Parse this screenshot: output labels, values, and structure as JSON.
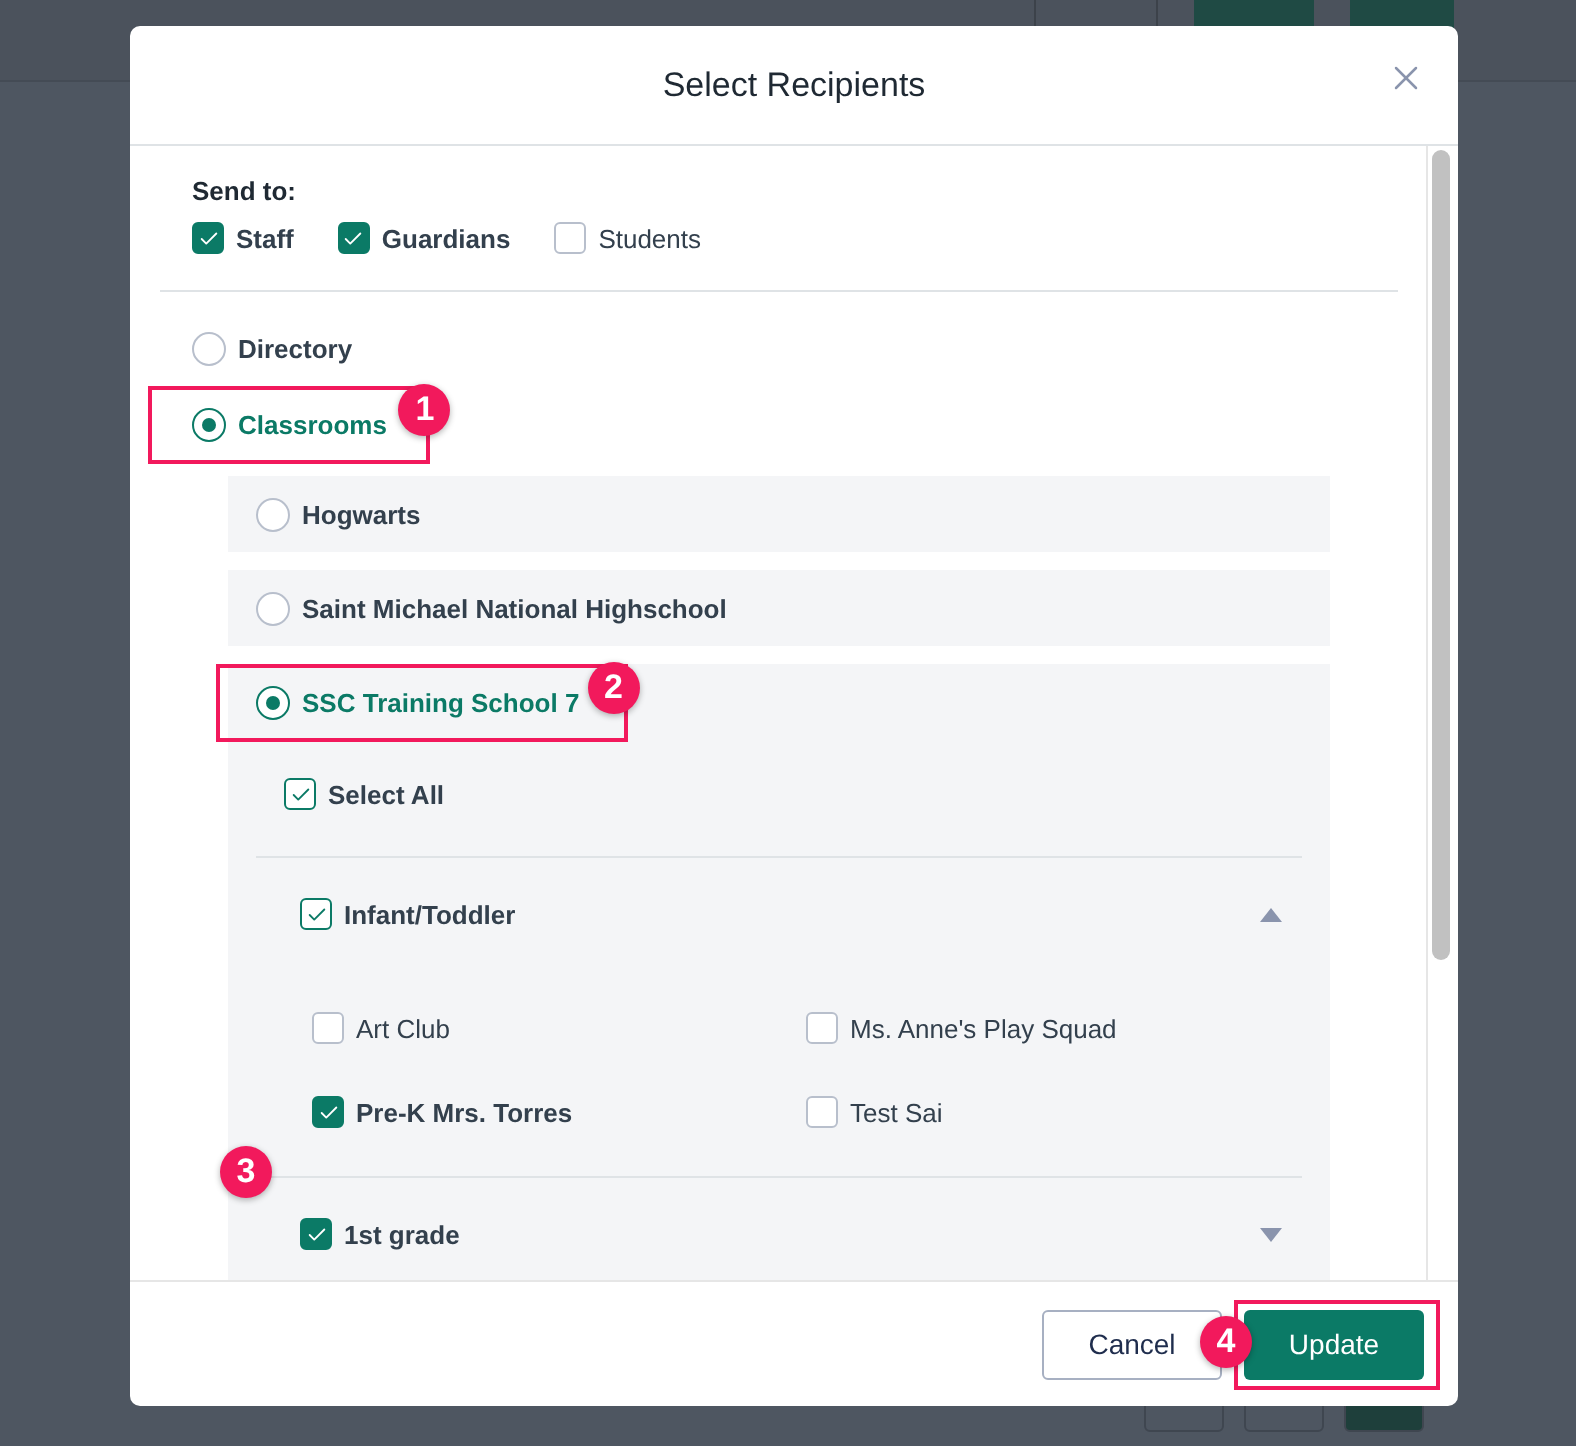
{
  "dialog": {
    "title": "Select Recipients",
    "send_to": {
      "label": "Send to:",
      "options": [
        {
          "label": "Staff",
          "checked": true
        },
        {
          "label": "Guardians",
          "checked": true
        },
        {
          "label": "Students",
          "checked": false
        }
      ]
    },
    "sources": [
      {
        "label": "Directory",
        "selected": false
      },
      {
        "label": "Classrooms",
        "selected": true,
        "callout": "1"
      }
    ],
    "schools": [
      {
        "name": "Hogwarts",
        "selected": false
      },
      {
        "name": "Saint Michael National Highschool",
        "selected": false
      },
      {
        "name": "SSC Training School 7",
        "selected": true,
        "callout": "2",
        "select_all": {
          "label": "Select All",
          "checked": true,
          "partial": true
        },
        "groups_callout": "3",
        "groups": [
          {
            "name": "Infant/Toddler",
            "checked": true,
            "partial": true,
            "expanded": true,
            "classes": [
              {
                "label": "Art Club",
                "checked": false
              },
              {
                "label": "Ms. Anne's Play Squad",
                "checked": false
              },
              {
                "label": "Pre-K Mrs. Torres",
                "checked": true
              },
              {
                "label": "Test Sai",
                "checked": false
              }
            ]
          },
          {
            "name": "1st grade",
            "checked": true,
            "expanded": false
          }
        ]
      }
    ],
    "buttons": [
      {
        "label": "Cancel",
        "kind": "secondary"
      },
      {
        "label": "Update",
        "kind": "primary",
        "callout": "4"
      }
    ]
  }
}
